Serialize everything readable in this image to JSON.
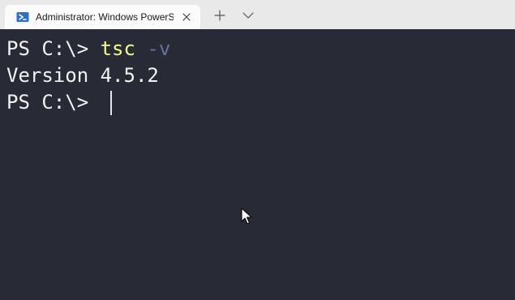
{
  "window": {
    "tab_title": "Administrator: Windows PowerS",
    "tab_icon": "powershell-icon",
    "close_icon": "close-icon",
    "new_tab_icon": "plus-icon",
    "dropdown_icon": "chevron-down-icon"
  },
  "terminal": {
    "lines": [
      {
        "prompt": "PS C:\\> ",
        "command": "tsc",
        "space": " ",
        "flag": "-v"
      },
      {
        "text": "Version 4.5.2"
      },
      {
        "prompt": "PS C:\\> "
      }
    ],
    "colors": {
      "background": "#282a36",
      "text": "#f2f2f2",
      "command": "#f1fa8c",
      "parameter": "#6272a4"
    }
  }
}
